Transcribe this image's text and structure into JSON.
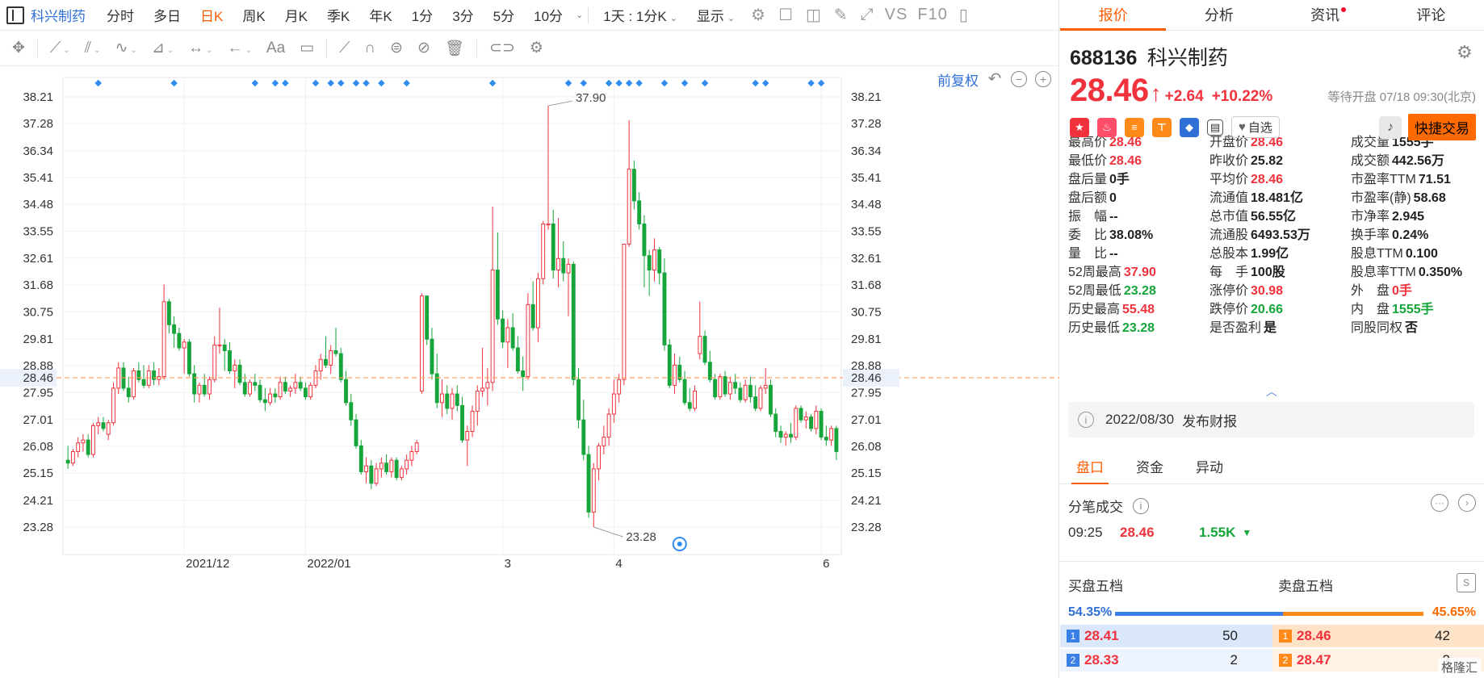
{
  "topbar": {
    "stock_name": "科兴制药",
    "periods": [
      "分时",
      "多日",
      "日K",
      "周K",
      "月K",
      "季K",
      "年K",
      "1分",
      "3分",
      "5分",
      "10分"
    ],
    "active_period": "日K",
    "range_select": "1天 : 1分K",
    "display_label": "显示",
    "vs_label": "VS",
    "f10_label": "F10"
  },
  "drawbar": {
    "text_tool_label": "Aa"
  },
  "chart": {
    "adjust_label": "前复权",
    "undo_icon": "undo-icon",
    "zoom_out_icon": "zoom-out-icon",
    "zoom_in_icon": "zoom-in-icon"
  },
  "chart_data": {
    "type": "candlestick",
    "y_ticks": [
      "38.21",
      "37.28",
      "36.34",
      "35.41",
      "34.48",
      "33.55",
      "32.61",
      "31.68",
      "30.75",
      "29.81",
      "28.88",
      "27.95",
      "27.01",
      "26.08",
      "25.15",
      "24.21",
      "23.28"
    ],
    "ylim": [
      23.28,
      38.21
    ],
    "x_ticks": [
      "2021/12",
      "2022/01",
      "3",
      "4",
      "6"
    ],
    "current_price_label": "28.46",
    "current_price": 28.46,
    "high_annotation": "37.90",
    "low_annotation": "23.28",
    "up_color": "#f0323c",
    "down_color": "#16a53a",
    "candles": [
      [
        25.6,
        26.1,
        25.3,
        25.5
      ],
      [
        25.5,
        26.0,
        25.4,
        25.9
      ],
      [
        25.9,
        26.4,
        25.7,
        26.2
      ],
      [
        26.2,
        26.5,
        25.9,
        26.3
      ],
      [
        26.3,
        26.5,
        25.7,
        25.8
      ],
      [
        25.8,
        26.9,
        25.7,
        26.8
      ],
      [
        26.8,
        27.1,
        26.5,
        26.9
      ],
      [
        26.9,
        27.1,
        26.6,
        26.7
      ],
      [
        26.5,
        27.0,
        26.3,
        26.9
      ],
      [
        26.9,
        28.3,
        26.8,
        28.1
      ],
      [
        28.1,
        29.0,
        27.9,
        28.8
      ],
      [
        28.8,
        29.0,
        28.0,
        28.1
      ],
      [
        28.1,
        28.5,
        27.6,
        27.8
      ],
      [
        27.8,
        28.8,
        27.7,
        28.7
      ],
      [
        28.7,
        29.0,
        28.3,
        28.4
      ],
      [
        28.4,
        28.9,
        28.1,
        28.2
      ],
      [
        28.2,
        28.9,
        28.1,
        28.7
      ],
      [
        28.7,
        29.0,
        28.2,
        28.4
      ],
      [
        28.4,
        28.8,
        28.2,
        28.5
      ],
      [
        28.5,
        31.7,
        28.4,
        31.1
      ],
      [
        31.1,
        31.2,
        30.0,
        30.3
      ],
      [
        30.3,
        30.6,
        29.5,
        30.0
      ],
      [
        30.0,
        30.2,
        29.4,
        29.5
      ],
      [
        29.5,
        29.8,
        28.6,
        29.7
      ],
      [
        29.7,
        29.8,
        28.5,
        28.6
      ],
      [
        28.6,
        28.9,
        27.6,
        27.9
      ],
      [
        27.9,
        28.3,
        27.6,
        28.2
      ],
      [
        28.2,
        28.6,
        27.8,
        27.9
      ],
      [
        27.9,
        28.5,
        27.7,
        28.4
      ],
      [
        28.4,
        29.9,
        28.3,
        29.6
      ],
      [
        29.6,
        30.9,
        29.3,
        29.6
      ],
      [
        29.6,
        29.8,
        28.7,
        29.4
      ],
      [
        29.4,
        29.7,
        28.6,
        28.7
      ],
      [
        28.7,
        29.1,
        28.1,
        28.9
      ],
      [
        28.9,
        29.1,
        28.2,
        28.3
      ],
      [
        28.3,
        28.6,
        27.8,
        27.9
      ],
      [
        27.9,
        28.4,
        27.8,
        28.3
      ],
      [
        28.3,
        28.6,
        28.0,
        28.2
      ],
      [
        28.2,
        28.4,
        27.6,
        27.7
      ],
      [
        27.7,
        28.1,
        27.3,
        27.6
      ],
      [
        27.6,
        28.1,
        27.5,
        27.9
      ],
      [
        27.9,
        28.1,
        27.6,
        27.8
      ],
      [
        27.8,
        28.5,
        27.7,
        28.3
      ],
      [
        28.3,
        28.5,
        27.9,
        28.0
      ],
      [
        28.0,
        28.2,
        27.8,
        28.1
      ],
      [
        28.1,
        28.6,
        27.9,
        28.3
      ],
      [
        28.3,
        28.5,
        28.0,
        28.1
      ],
      [
        28.1,
        28.3,
        27.7,
        27.8
      ],
      [
        27.8,
        28.3,
        27.7,
        28.2
      ],
      [
        28.2,
        28.9,
        28.1,
        28.7
      ],
      [
        28.7,
        29.3,
        28.4,
        29.1
      ],
      [
        29.1,
        29.9,
        28.8,
        28.9
      ],
      [
        28.9,
        29.6,
        28.6,
        29.4
      ],
      [
        29.4,
        30.2,
        29.2,
        29.3
      ],
      [
        29.3,
        29.5,
        28.3,
        28.4
      ],
      [
        28.4,
        28.7,
        27.5,
        27.6
      ],
      [
        27.6,
        27.9,
        26.8,
        27.0
      ],
      [
        27.0,
        27.2,
        26.0,
        26.1
      ],
      [
        26.1,
        26.3,
        25.1,
        25.2
      ],
      [
        25.2,
        25.7,
        24.8,
        25.4
      ],
      [
        25.4,
        25.6,
        24.6,
        24.8
      ],
      [
        24.8,
        25.5,
        24.7,
        25.3
      ],
      [
        25.3,
        25.7,
        25.0,
        25.5
      ],
      [
        25.5,
        25.8,
        25.1,
        25.2
      ],
      [
        25.2,
        25.7,
        25.0,
        25.6
      ],
      [
        25.6,
        25.7,
        24.9,
        25.0
      ],
      [
        25.0,
        25.4,
        24.9,
        25.3
      ],
      [
        25.3,
        25.8,
        25.1,
        25.6
      ],
      [
        25.6,
        26.1,
        25.4,
        25.9
      ],
      [
        25.9,
        26.3,
        25.8,
        26.2
      ],
      [
        28.0,
        31.4,
        27.9,
        31.3
      ],
      [
        31.3,
        31.3,
        29.6,
        29.8
      ],
      [
        29.8,
        30.2,
        28.4,
        28.6
      ],
      [
        28.6,
        29.3,
        27.4,
        27.6
      ],
      [
        27.6,
        28.4,
        27.1,
        27.9
      ],
      [
        27.9,
        28.2,
        27.2,
        27.4
      ],
      [
        27.4,
        28.1,
        27.0,
        27.9
      ],
      [
        27.9,
        28.2,
        27.3,
        27.5
      ],
      [
        27.5,
        27.8,
        26.2,
        26.3
      ],
      [
        26.3,
        26.8,
        25.4,
        26.6
      ],
      [
        26.6,
        27.5,
        26.4,
        27.3
      ],
      [
        27.3,
        28.2,
        26.8,
        28.0
      ],
      [
        28.0,
        29.5,
        27.8,
        28.1
      ],
      [
        28.1,
        28.8,
        27.5,
        28.3
      ],
      [
        28.3,
        34.4,
        28.0,
        32.2
      ],
      [
        32.2,
        33.5,
        30.3,
        30.5
      ],
      [
        30.5,
        30.8,
        29.5,
        29.7
      ],
      [
        29.7,
        30.5,
        28.8,
        30.2
      ],
      [
        30.2,
        30.7,
        29.4,
        29.5
      ],
      [
        29.5,
        29.9,
        28.6,
        28.7
      ],
      [
        28.7,
        29.2,
        28.0,
        28.5
      ],
      [
        28.5,
        31.4,
        28.4,
        31.0
      ],
      [
        31.0,
        31.8,
        30.1,
        30.2
      ],
      [
        30.2,
        32.1,
        29.7,
        31.9
      ],
      [
        31.9,
        33.9,
        31.7,
        33.8
      ],
      [
        33.8,
        37.9,
        33.6,
        33.8
      ],
      [
        33.8,
        34.3,
        31.9,
        32.2
      ],
      [
        32.2,
        34.0,
        31.6,
        32.6
      ],
      [
        32.6,
        33.2,
        31.8,
        32.1
      ],
      [
        32.1,
        32.6,
        30.6,
        32.4
      ],
      [
        32.4,
        32.5,
        28.2,
        28.4
      ],
      [
        28.4,
        28.8,
        26.7,
        27.0
      ],
      [
        27.0,
        27.7,
        25.6,
        25.8
      ],
      [
        25.8,
        26.1,
        23.6,
        23.8
      ],
      [
        23.8,
        25.5,
        23.28,
        25.3
      ],
      [
        25.3,
        26.2,
        24.9,
        26.1
      ],
      [
        26.1,
        26.8,
        25.8,
        26.4
      ],
      [
        26.4,
        27.4,
        26.1,
        27.2
      ],
      [
        27.2,
        28.4,
        26.9,
        27.9
      ],
      [
        27.9,
        28.6,
        27.6,
        28.4
      ],
      [
        28.4,
        33.0,
        28.2,
        33.1
      ],
      [
        33.1,
        37.4,
        33.0,
        35.7
      ],
      [
        35.7,
        36.0,
        34.3,
        34.6
      ],
      [
        34.6,
        34.9,
        33.6,
        33.8
      ],
      [
        33.8,
        34.1,
        31.6,
        32.7
      ],
      [
        32.7,
        32.9,
        31.3,
        32.2
      ],
      [
        32.2,
        33.3,
        31.8,
        32.9
      ],
      [
        32.9,
        33.0,
        31.7,
        32.1
      ],
      [
        32.1,
        32.6,
        29.4,
        29.6
      ],
      [
        29.6,
        29.8,
        28.1,
        28.2
      ],
      [
        28.2,
        29.3,
        27.9,
        28.9
      ],
      [
        28.9,
        29.2,
        28.3,
        28.4
      ],
      [
        28.4,
        28.7,
        27.5,
        27.6
      ],
      [
        27.6,
        28.1,
        27.3,
        27.4
      ],
      [
        27.4,
        28.2,
        27.3,
        28.0
      ],
      [
        29.3,
        31.1,
        29.1,
        29.9
      ],
      [
        29.9,
        30.1,
        28.9,
        29.0
      ],
      [
        29.0,
        29.4,
        28.3,
        28.4
      ],
      [
        28.4,
        28.6,
        27.7,
        27.8
      ],
      [
        27.8,
        28.6,
        27.7,
        28.5
      ],
      [
        28.5,
        28.7,
        27.8,
        27.9
      ],
      [
        27.9,
        28.5,
        27.7,
        28.3
      ],
      [
        28.3,
        28.6,
        27.9,
        28.1
      ],
      [
        28.1,
        28.3,
        27.6,
        27.7
      ],
      [
        27.7,
        28.4,
        27.6,
        28.2
      ],
      [
        28.2,
        28.5,
        27.6,
        27.8
      ],
      [
        27.8,
        28.2,
        27.3,
        27.4
      ],
      [
        27.4,
        28.2,
        27.3,
        28.1
      ],
      [
        28.1,
        28.8,
        27.9,
        28.2
      ],
      [
        28.2,
        28.4,
        27.1,
        27.2
      ],
      [
        27.2,
        27.4,
        26.4,
        26.6
      ],
      [
        26.6,
        26.8,
        26.2,
        26.4
      ],
      [
        26.4,
        26.6,
        26.1,
        26.5
      ],
      [
        26.5,
        26.9,
        26.2,
        26.4
      ],
      [
        26.4,
        27.5,
        26.3,
        27.4
      ],
      [
        27.4,
        27.5,
        26.9,
        27.0
      ],
      [
        27.0,
        27.3,
        26.7,
        27.1
      ],
      [
        27.1,
        27.2,
        26.6,
        26.7
      ],
      [
        26.7,
        27.5,
        26.5,
        27.3
      ],
      [
        27.3,
        27.4,
        26.3,
        26.4
      ],
      [
        26.4,
        26.8,
        26.1,
        26.3
      ],
      [
        26.3,
        26.8,
        26.1,
        26.7
      ],
      [
        26.7,
        26.8,
        25.6,
        25.9
      ]
    ]
  },
  "right": {
    "tabs": [
      "报价",
      "分析",
      "资讯",
      "评论"
    ],
    "active_tab": "报价",
    "code": "688136",
    "name": "科兴制药",
    "price": "28.46",
    "change": "+2.64",
    "change_pct": "+10.22%",
    "status": "等待开盘 07/18 09:30(北京)",
    "zixuan_label": "自选",
    "quick_trade_label": "快捷交易",
    "stats": [
      {
        "label": "最高价",
        "value": "28.46",
        "color": "up"
      },
      {
        "label": "开盘价",
        "value": "28.46",
        "color": "up"
      },
      {
        "label": "成交量",
        "value": "1555手",
        "color": "neu"
      },
      {
        "label": "最低价",
        "value": "28.46",
        "color": "up"
      },
      {
        "label": "昨收价",
        "value": "25.82",
        "color": "neu"
      },
      {
        "label": "成交额",
        "value": "442.56万",
        "color": "neu"
      },
      {
        "label": "盘后量",
        "value": "0手",
        "color": "neu"
      },
      {
        "label": "平均价",
        "value": "28.46",
        "color": "up"
      },
      {
        "label": "市盈率TTM",
        "value": "71.51",
        "color": "neu"
      },
      {
        "label": "盘后额",
        "value": "0",
        "color": "neu"
      },
      {
        "label": "流通值",
        "value": "18.481亿",
        "color": "neu"
      },
      {
        "label": "市盈率(静)",
        "value": "58.68",
        "color": "neu"
      },
      {
        "label": "振　幅",
        "value": "--",
        "color": "neu"
      },
      {
        "label": "总市值",
        "value": "56.55亿",
        "color": "neu"
      },
      {
        "label": "市净率",
        "value": "2.945",
        "color": "neu"
      },
      {
        "label": "委　比",
        "value": "38.08%",
        "color": "neu"
      },
      {
        "label": "流通股",
        "value": "6493.53万",
        "color": "neu"
      },
      {
        "label": "换手率",
        "value": "0.24%",
        "color": "neu"
      },
      {
        "label": "量　比",
        "value": "--",
        "color": "neu"
      },
      {
        "label": "总股本",
        "value": "1.99亿",
        "color": "neu"
      },
      {
        "label": "股息TTM",
        "value": "0.100",
        "color": "neu"
      },
      {
        "label": "52周最高",
        "value": "37.90",
        "color": "up"
      },
      {
        "label": "每　手",
        "value": "100股",
        "color": "neu"
      },
      {
        "label": "股息率TTM",
        "value": "0.350%",
        "color": "neu"
      },
      {
        "label": "52周最低",
        "value": "23.28",
        "color": "down"
      },
      {
        "label": "涨停价",
        "value": "30.98",
        "color": "up"
      },
      {
        "label": "外　盘",
        "value": "0手",
        "color": "up"
      },
      {
        "label": "历史最高",
        "value": "55.48",
        "color": "up"
      },
      {
        "label": "跌停价",
        "value": "20.66",
        "color": "down"
      },
      {
        "label": "内　盘",
        "value": "1555手",
        "color": "down"
      },
      {
        "label": "历史最低",
        "value": "23.28",
        "color": "down"
      },
      {
        "label": "是否盈利",
        "value": "是",
        "color": "neu"
      },
      {
        "label": "同股同权",
        "value": "否",
        "color": "neu"
      }
    ],
    "report_date": "2022/08/30",
    "report_label": "发布财报",
    "subtabs": [
      "盘口",
      "资金",
      "异动"
    ],
    "active_subtab": "盘口",
    "tick_header": "分笔成交",
    "tick_time": "09:25",
    "tick_price": "28.46",
    "tick_volume": "1.55K",
    "buy_header": "买盘五档",
    "sell_header": "卖盘五档",
    "buy_ratio": "54.35%",
    "buy_ratio_value": 54.35,
    "sell_ratio": "45.65%",
    "buy_levels": [
      {
        "n": "1",
        "price": "28.41",
        "vol": "50"
      },
      {
        "n": "2",
        "price": "28.33",
        "vol": "2"
      }
    ],
    "sell_levels": [
      {
        "n": "1",
        "price": "28.46",
        "vol": "42"
      },
      {
        "n": "2",
        "price": "28.47",
        "vol": "2"
      }
    ],
    "watermark": "格隆汇"
  }
}
